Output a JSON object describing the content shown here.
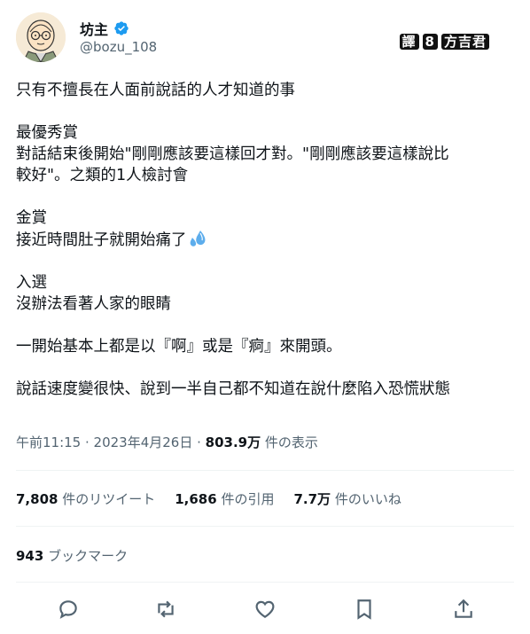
{
  "user": {
    "display_name": "坊主",
    "handle": "@bozu_108"
  },
  "watermark": {
    "prefix": "譯",
    "badge": "8",
    "suffix": "方吉君"
  },
  "tweet": {
    "line1": "只有不擅長在人面前說話的人才知道的事",
    "award1_title": "最優秀賞",
    "award1_line1": "對話結束後開始\"剛剛應該要這樣回才對。\"剛剛應該要這樣說比",
    "award1_line2": "較好\"。之類的1人檢討會",
    "award2_title": "金賞",
    "award2_text": "接近時間肚子就開始痛了",
    "award2_emoji": "sweat-droplets-icon",
    "award3_title": "入選",
    "award3_text": "沒辦法看著人家的眼睛",
    "para1": "一開始基本上都是以『啊』或是『痾』來開頭。",
    "para2": "說話速度變很快、說到一半自己都不知道在說什麼陷入恐慌狀態"
  },
  "meta": {
    "time": "午前11:15 · 2023年4月26日 · ",
    "views": "803.9万",
    "views_label": " 件の表示"
  },
  "stats": {
    "retweets": "7,808",
    "retweets_label": " 件のリツイート",
    "quotes": "1,686",
    "quotes_label": " 件の引用",
    "likes": "7.7万",
    "likes_label": " 件のいいね"
  },
  "bookmarks": {
    "count": "943",
    "label": " ブックマーク"
  },
  "actions": [
    "reply-icon",
    "retweet-icon",
    "like-icon",
    "bookmark-icon",
    "share-icon"
  ],
  "colors": {
    "verified": "#1d9bf0",
    "text": "#0f1419",
    "secondary": "#536471",
    "divider": "#eff3f4"
  }
}
